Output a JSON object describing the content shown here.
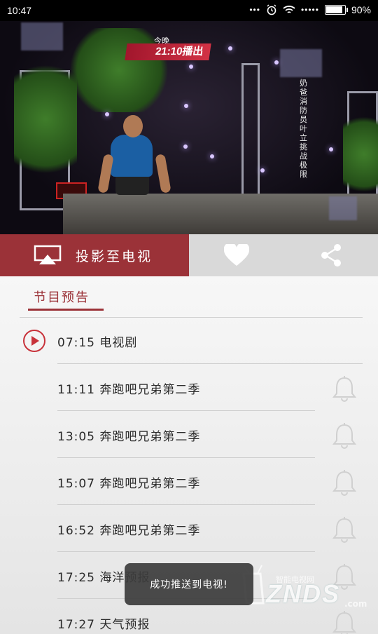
{
  "status_bar": {
    "time": "10:47",
    "signal_dots": "•••",
    "signal_dots_right": "•••••",
    "battery": "90%",
    "battery_level": 0.9
  },
  "video": {
    "banner_top": "今晚",
    "banner_main": "21:10播出",
    "side_caption": "奶爸消防员叶立挑战极限"
  },
  "action_bar": {
    "cast_label": "投影至电视",
    "cast_icon": "airplay-icon",
    "favorite_icon": "heart-icon",
    "share_icon": "share-icon",
    "colors": {
      "accent": "#9b3238",
      "inactive": "#d9d9d9"
    }
  },
  "schedule": {
    "title": "节目预告",
    "items": [
      {
        "label": "07:15 电视剧",
        "icon": "play-icon"
      },
      {
        "label": "11:11 奔跑吧兄弟第二季",
        "icon": "bell-icon"
      },
      {
        "label": "13:05 奔跑吧兄弟第二季",
        "icon": "bell-icon"
      },
      {
        "label": "15:07 奔跑吧兄弟第二季",
        "icon": "bell-icon"
      },
      {
        "label": "16:52 奔跑吧兄弟第二季",
        "icon": "bell-icon"
      },
      {
        "label": "17:25 海洋预报",
        "icon": "bell-icon"
      },
      {
        "label": "17:27 天气预报",
        "icon": "bell-icon"
      }
    ]
  },
  "toast": {
    "text": "成功推送到电视!"
  },
  "watermark": {
    "top": "智能电视网",
    "main": "ZNDS",
    "suffix": ".com"
  }
}
